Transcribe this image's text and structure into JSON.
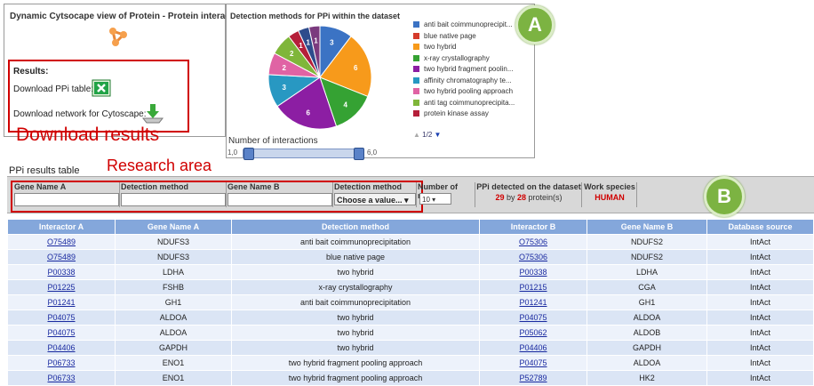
{
  "cytoscape": {
    "title": "Dynamic Cytsocape view of Protein - Protein interaction",
    "results_title": "Results:",
    "download_ppi_label": "Download PPi table:",
    "download_network_label": "Download network for Cytoscape:"
  },
  "annotations": {
    "download_results": "Download results",
    "research_area": "Research area",
    "badge_a": "A",
    "badge_b": "B"
  },
  "chart_data": {
    "type": "pie",
    "title": "Detection methods for PPi within the dataset",
    "slices": [
      {
        "label": "anti bait coimmunoprecipit...",
        "value": 3,
        "color": "#3b73c4"
      },
      {
        "label": "blue native page",
        "value": 0,
        "color": "#d53b2b"
      },
      {
        "label": "two hybrid",
        "value": 6,
        "color": "#f79a1b"
      },
      {
        "label": "x-ray crystallography",
        "value": 4,
        "color": "#35a233"
      },
      {
        "label": "two hybrid fragment poolin...",
        "value": 6,
        "color": "#8c1ea3"
      },
      {
        "label": "affinity chromatography te...",
        "value": 3,
        "color": "#2898c2"
      },
      {
        "label": "two hybrid pooling approach",
        "value": 2,
        "color": "#e063a4"
      },
      {
        "label": "anti tag coimmunoprecipita...",
        "value": 2,
        "color": "#7fb63a"
      },
      {
        "label": "protein kinase assay",
        "value": 1,
        "color": "#b51f3a"
      },
      {
        "label": "",
        "value": 1,
        "color": "#2e4c8c"
      },
      {
        "label": "",
        "value": 1,
        "color": "#7b3a7e"
      }
    ],
    "legend_pager": "1/2",
    "slider_label": "Number of interactions",
    "slider_min": "1,0",
    "slider_max": "6,0",
    "slider_range": [
      0,
      1
    ]
  },
  "filters": {
    "table_title": "PPi results table",
    "gene_name_a": "Gene Name A",
    "detection_method_col": "Detection method",
    "gene_name_b": "Gene Name B",
    "detection_method_select_label": "Detection method",
    "detection_method_select_value": "Choose a value...",
    "rows_label": "Number of rows",
    "rows_value": "10",
    "ppi_detected_label": "PPi detected on the dataset",
    "ppi_count": "29",
    "ppi_by": "by",
    "protein_count": "28",
    "protein_suffix": "protein(s)",
    "work_species_label": "Work species",
    "work_species_value": "HUMAN"
  },
  "table": {
    "headers": [
      "Interactor A",
      "Gene Name A",
      "Detection method",
      "Interactor B",
      "Gene Name B",
      "Database source"
    ],
    "rows": [
      [
        "O75489",
        "NDUFS3",
        "anti bait coimmunoprecipitation",
        "O75306",
        "NDUFS2",
        "IntAct"
      ],
      [
        "O75489",
        "NDUFS3",
        "blue native page",
        "O75306",
        "NDUFS2",
        "IntAct"
      ],
      [
        "P00338",
        "LDHA",
        "two hybrid",
        "P00338",
        "LDHA",
        "IntAct"
      ],
      [
        "P01225",
        "FSHB",
        "x-ray crystallography",
        "P01215",
        "CGA",
        "IntAct"
      ],
      [
        "P01241",
        "GH1",
        "anti bait coimmunoprecipitation",
        "P01241",
        "GH1",
        "IntAct"
      ],
      [
        "P04075",
        "ALDOA",
        "two hybrid",
        "P04075",
        "ALDOA",
        "IntAct"
      ],
      [
        "P04075",
        "ALDOA",
        "two hybrid",
        "P05062",
        "ALDOB",
        "IntAct"
      ],
      [
        "P04406",
        "GAPDH",
        "two hybrid",
        "P04406",
        "GAPDH",
        "IntAct"
      ],
      [
        "P06733",
        "ENO1",
        "two hybrid fragment pooling approach",
        "P04075",
        "ALDOA",
        "IntAct"
      ],
      [
        "P06733",
        "ENO1",
        "two hybrid fragment pooling approach",
        "P52789",
        "HK2",
        "IntAct"
      ]
    ]
  }
}
